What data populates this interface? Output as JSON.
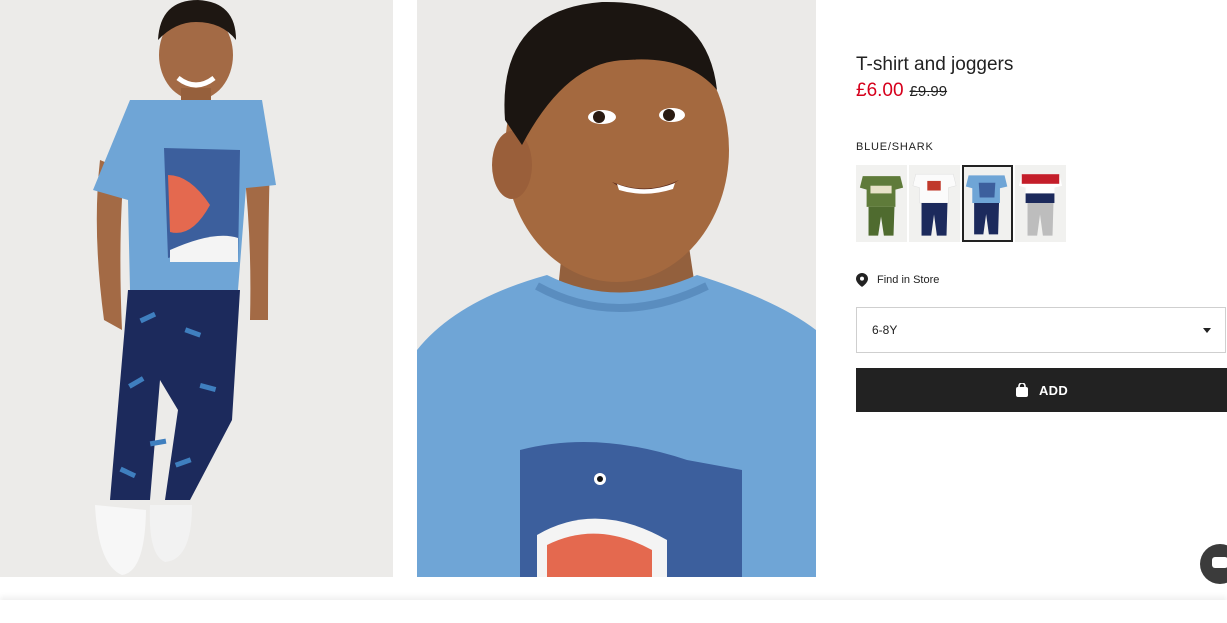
{
  "product": {
    "title": "T-shirt and joggers",
    "price_current": "£6.00",
    "price_original": "£9.99",
    "color_name": "BLUE/SHARK"
  },
  "swatches": [
    {
      "name": "green-dinosaur",
      "active": false
    },
    {
      "name": "white-graphic",
      "active": false
    },
    {
      "name": "blue-shark",
      "active": true
    },
    {
      "name": "red-new-york",
      "active": false
    }
  ],
  "find_in_store": {
    "label": "Find in Store",
    "icon": "location-pin-icon"
  },
  "size_select": {
    "value": "6-8Y"
  },
  "add_button": {
    "label": "ADD",
    "icon": "shopping-bag-icon"
  },
  "colors": {
    "accent_sale": "#d6001c",
    "button_bg": "#222222",
    "tshirt_blue": "#6fa5d6",
    "joggers_navy": "#1c2a5c"
  }
}
